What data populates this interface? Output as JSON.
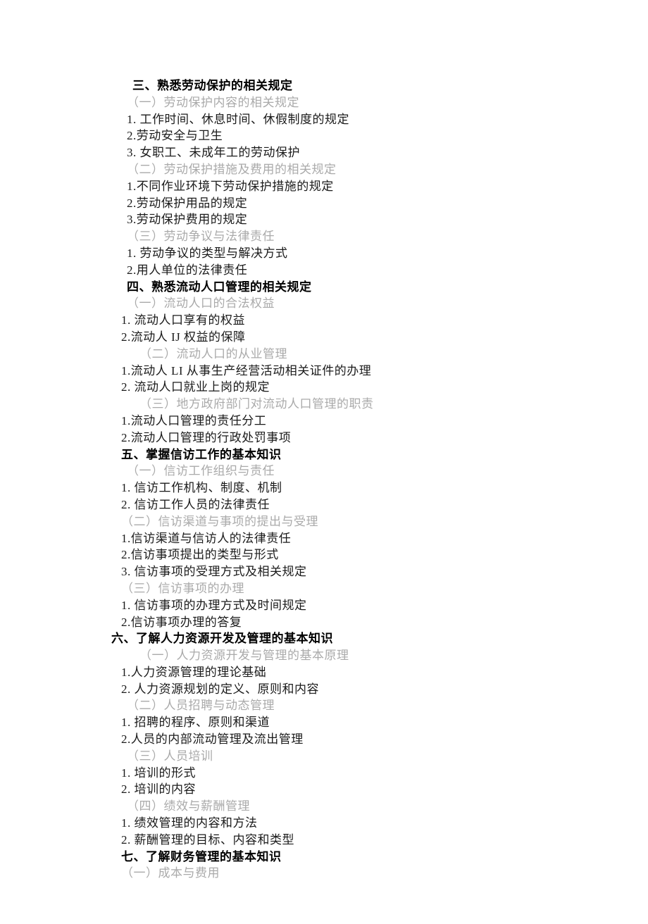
{
  "lines": [
    {
      "cls": "line bold indent-a",
      "key": "s3_title"
    },
    {
      "cls": "line gray indent-b",
      "key": "s3_1_title"
    },
    {
      "cls": "line indent-b",
      "key": "s3_1_1"
    },
    {
      "cls": "line indent-b",
      "key": "s3_1_2"
    },
    {
      "cls": "line indent-b",
      "key": "s3_1_3"
    },
    {
      "cls": "line gray indent-b",
      "key": "s3_2_title"
    },
    {
      "cls": "line indent-b",
      "key": "s3_2_1"
    },
    {
      "cls": "line indent-b",
      "key": "s3_2_2"
    },
    {
      "cls": "line indent-b",
      "key": "s3_2_3"
    },
    {
      "cls": "line gray indent-b",
      "key": "s3_3_title"
    },
    {
      "cls": "line indent-b",
      "key": "s3_3_1"
    },
    {
      "cls": "line indent-b",
      "key": "s3_3_2"
    },
    {
      "cls": "line bold indent-b",
      "key": "s4_title"
    },
    {
      "cls": "line gray indent-b",
      "key": "s4_1_title"
    },
    {
      "cls": "line indent-c",
      "key": "s4_1_1"
    },
    {
      "cls": "line indent-c",
      "key": "s4_1_2"
    },
    {
      "cls": "line gray indent-e",
      "key": "s4_2_title"
    },
    {
      "cls": "line indent-c",
      "key": "s4_2_1"
    },
    {
      "cls": "line indent-c",
      "key": "s4_2_2"
    },
    {
      "cls": "line gray indent-e",
      "key": "s4_3_title"
    },
    {
      "cls": "line indent-c",
      "key": "s4_3_1"
    },
    {
      "cls": "line indent-c",
      "key": "s4_3_2"
    },
    {
      "cls": "line bold indent-c",
      "key": "s5_title"
    },
    {
      "cls": "line gray indent-b",
      "key": "s5_1_title"
    },
    {
      "cls": "line indent-c",
      "key": "s5_1_1"
    },
    {
      "cls": "line indent-c",
      "key": "s5_1_2"
    },
    {
      "cls": "line gray indent-c",
      "key": "s5_2_title"
    },
    {
      "cls": "line indent-c",
      "key": "s5_2_1"
    },
    {
      "cls": "line indent-c",
      "key": "s5_2_2"
    },
    {
      "cls": "line indent-c",
      "key": "s5_2_3"
    },
    {
      "cls": "line gray indent-c",
      "key": "s5_3_title"
    },
    {
      "cls": "line indent-c",
      "key": "s5_3_1"
    },
    {
      "cls": "line indent-c",
      "key": "s5_3_2"
    },
    {
      "cls": "line bold indent-f",
      "key": "s6_title"
    },
    {
      "cls": "line gray indent-e",
      "key": "s6_1_title"
    },
    {
      "cls": "line indent-c",
      "key": "s6_1_1"
    },
    {
      "cls": "line indent-c",
      "key": "s6_1_2"
    },
    {
      "cls": "line gray indent-b",
      "key": "s6_2_title"
    },
    {
      "cls": "line indent-c",
      "key": "s6_2_1"
    },
    {
      "cls": "line indent-c",
      "key": "s6_2_2"
    },
    {
      "cls": "line gray indent-b",
      "key": "s6_3_title"
    },
    {
      "cls": "line indent-c",
      "key": "s6_3_1"
    },
    {
      "cls": "line indent-c",
      "key": "s6_3_2"
    },
    {
      "cls": "line gray indent-b",
      "key": "s6_4_title"
    },
    {
      "cls": "line indent-c",
      "key": "s6_4_1"
    },
    {
      "cls": "line indent-c",
      "key": "s6_4_2"
    },
    {
      "cls": "line bold indent-c",
      "key": "s7_title"
    },
    {
      "cls": "line gray indent-c",
      "key": "s7_1_title"
    }
  ],
  "text": {
    "s3_title": "三、熟悉劳动保护的相关规定",
    "s3_1_title": "（一）劳动保护内容的相关规定",
    "s3_1_1": "1. 工作时间、休息时间、休假制度的规定",
    "s3_1_2": "2.劳动安全与卫生",
    "s3_1_3": "3. 女职工、未成年工的劳动保护",
    "s3_2_title": "（二）劳动保护措施及费用的相关规定",
    "s3_2_1": "1.不同作业环境下劳动保护措施的规定",
    "s3_2_2": "2.劳动保护用品的规定",
    "s3_2_3": "3.劳动保护费用的规定",
    "s3_3_title": "（三）劳动争议与法律责任",
    "s3_3_1": "1. 劳动争议的类型与解决方式",
    "s3_3_2": "2.用人单位的法律责任",
    "s4_title": "四、熟悉流动人口管理的相关规定",
    "s4_1_title": "（一）流动人口的合法权益",
    "s4_1_1": "1. 流动人口享有的权益",
    "s4_1_2": "2.流动人 IJ 权益的保障",
    "s4_2_title": "（二）流动人口的从业管理",
    "s4_2_1": "1.流动人 LI 从事生产经营活动相关证件的办理",
    "s4_2_2": "2. 流动人口就业上岗的规定",
    "s4_3_title": "（三）地方政府部门对流动人口管理的职责",
    "s4_3_1": "1.流动人口管理的责任分工",
    "s4_3_2": "2.流动人口管理的行政处罚事项",
    "s5_title": "五、掌握信访工作的基本知识",
    "s5_1_title": "（一）信访工作组织与责任",
    "s5_1_1": "1. 信访工作机构、制度、机制",
    "s5_1_2": "2. 信访工作人员的法律责任",
    "s5_2_title": "（二）信访渠道与事项的提出与受理",
    "s5_2_1": "1.信访渠道与信访人的法律责任",
    "s5_2_2": "2.信访事项提出的类型与形式",
    "s5_2_3": "3. 信访事项的受理方式及相关规定",
    "s5_3_title": "（三）信访事项的办理",
    "s5_3_1": "1. 信访事项的办理方式及时间规定",
    "s5_3_2": "2.信访事项办理的答复",
    "s6_title": "六、了解人力资源开发及管理的基本知识",
    "s6_1_title": "（一）人力资源开发与管理的基本原理",
    "s6_1_1": "1.人力资源管理的理论基础",
    "s6_1_2": "2. 人力资源规划的定义、原则和内容",
    "s6_2_title": "（二）人员招聘与动态管理",
    "s6_2_1": "1. 招聘的程序、原则和渠道",
    "s6_2_2": "2.人员的内部流动管理及流出管理",
    "s6_3_title": "（三）人员培训",
    "s6_3_1": "1. 培训的形式",
    "s6_3_2": "2. 培训的内容",
    "s6_4_title": "（四）绩效与薪酬管理",
    "s6_4_1": "1. 绩效管理的内容和方法",
    "s6_4_2": "2. 薪酬管理的目标、内容和类型",
    "s7_title": "七、了解财务管理的基本知识",
    "s7_1_title": "（一）成本与费用"
  }
}
